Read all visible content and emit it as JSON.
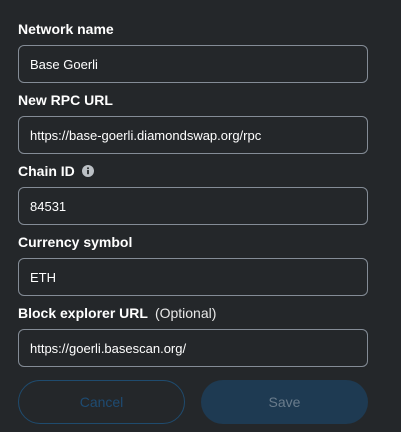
{
  "fields": {
    "network_name": {
      "label": "Network name",
      "value": "Base Goerli"
    },
    "rpc_url": {
      "label": "New RPC URL",
      "value": "https://base-goerli.diamondswap.org/rpc"
    },
    "chain_id": {
      "label": "Chain ID",
      "value": "84531",
      "info_icon": "info-icon"
    },
    "currency_symbol": {
      "label": "Currency symbol",
      "value": "ETH"
    },
    "block_explorer": {
      "label": "Block explorer URL",
      "optional_text": "(Optional)",
      "value": "https://goerli.basescan.org/"
    }
  },
  "buttons": {
    "cancel_label": "Cancel",
    "save_label": "Save"
  },
  "colors": {
    "background": "#24272a",
    "input_border": "#848c96",
    "cancel_text": "#1e4b72",
    "save_background": "#1e3a52",
    "save_text": "#6a7c8c"
  }
}
